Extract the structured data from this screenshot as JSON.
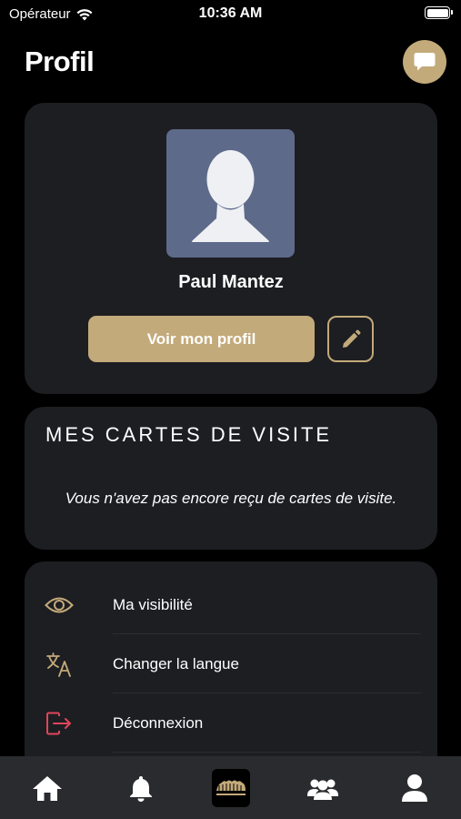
{
  "status_bar": {
    "carrier": "Opérateur",
    "time": "10:36 AM"
  },
  "header": {
    "title": "Profil"
  },
  "profile": {
    "name": "Paul Mantez",
    "view_button_label": "Voir mon profil"
  },
  "business_cards": {
    "title": "MES CARTES DE VISITE",
    "empty_message": "Vous n'avez pas encore reçu de cartes de visite."
  },
  "menu": {
    "items": [
      {
        "label": "Ma visibilité",
        "icon": "eye-icon"
      },
      {
        "label": "Changer la langue",
        "icon": "translate-icon"
      },
      {
        "label": "Déconnexion",
        "icon": "logout-icon"
      }
    ]
  },
  "tab_bar": {
    "tabs": [
      {
        "icon": "home-icon"
      },
      {
        "icon": "bell-icon"
      },
      {
        "icon": "app-logo-icon"
      },
      {
        "icon": "community-icon"
      },
      {
        "icon": "profile-icon"
      }
    ]
  },
  "colors": {
    "accent": "#c3aa7a",
    "card_bg": "#1d1e22",
    "logout_red": "#e0455a",
    "background": "#000000"
  }
}
